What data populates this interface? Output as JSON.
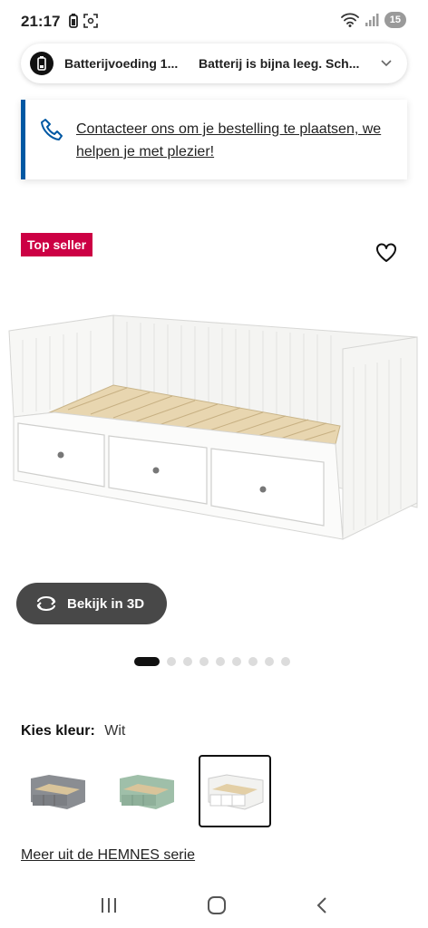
{
  "status_bar": {
    "time": "21:17",
    "battery_level": "15",
    "icons": [
      "battery-saver-icon",
      "screenshot-icon",
      "wifi-icon",
      "signal-icon"
    ]
  },
  "notification": {
    "title": "Batterijvoeding 1...",
    "text": "Batterij is bijna leeg. Sch...",
    "icon": "battery-icon"
  },
  "contact_banner": {
    "text": "Contacteer ons om je bestelling te plaatsen, we helpen je met plezier!",
    "icon": "phone-icon"
  },
  "product": {
    "badge": "Top seller",
    "view_3d_label": "Bekijk in 3D",
    "image_count": 9,
    "active_image_index": 0
  },
  "color_selector": {
    "label": "Kies kleur:",
    "selected_value": "Wit",
    "options": [
      {
        "name": "grijs",
        "color": "#8a8d92"
      },
      {
        "name": "groen",
        "color": "#9fbfa9"
      },
      {
        "name": "wit",
        "color": "#f2f2f0",
        "selected": true
      }
    ]
  },
  "series_link": "Meer uit de HEMNES serie",
  "colors": {
    "accent_blue": "#0058a3",
    "badge_red": "#cc0044",
    "button_dark": "#484848"
  }
}
